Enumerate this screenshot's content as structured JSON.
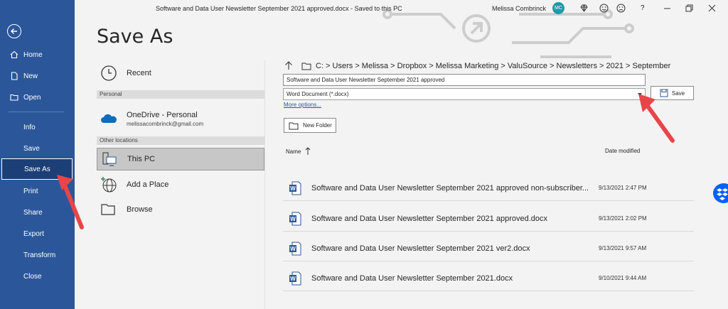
{
  "window": {
    "doc_title": "Software and Data User Newsletter September 2021 approved.docx  -  Saved to this PC",
    "user_name": "Melissa Combrinck",
    "user_initials": "MC",
    "help_label": "?"
  },
  "nav": {
    "items": [
      {
        "label": "Home"
      },
      {
        "label": "New"
      },
      {
        "label": "Open"
      },
      {
        "label": "Info"
      },
      {
        "label": "Save"
      },
      {
        "label": "Save As"
      },
      {
        "label": "Print"
      },
      {
        "label": "Share"
      },
      {
        "label": "Export"
      },
      {
        "label": "Transform"
      },
      {
        "label": "Close"
      }
    ]
  },
  "page": {
    "title": "Save As"
  },
  "locations": {
    "recent": "Recent",
    "personal_header": "Personal",
    "onedrive_name": "OneDrive - Personal",
    "onedrive_email": "melissacombrinck@gmail.com",
    "other_header": "Other locations",
    "this_pc": "This PC",
    "add_place": "Add a Place",
    "browse": "Browse"
  },
  "save_pane": {
    "path": "C: > Users > Melissa > Dropbox > Melissa Marketing > ValuSource > Newsletters > 2021 > September",
    "filename": "Software and Data User Newsletter September 2021 approved",
    "filetype": "Word Document (*.docx)",
    "save_label": "Save",
    "more_options": "More options...",
    "new_folder": "New Folder",
    "col_name": "Name",
    "col_date": "Date modified"
  },
  "files": [
    {
      "name": "Software and Data User Newsletter September 2021 approved non-subscriber...",
      "date": "9/13/2021 2:47 PM"
    },
    {
      "name": "Software and Data User Newsletter September 2021 approved.docx",
      "date": "9/13/2021 2:02 PM"
    },
    {
      "name": "Software and Data User Newsletter September 2021 ver2.docx",
      "date": "9/13/2021 9:57 AM"
    },
    {
      "name": "Software and Data User Newsletter September 2021.docx",
      "date": "9/10/2021 9:44 AM"
    }
  ],
  "colors": {
    "nav_bg": "#2b579a",
    "nav_active": "#1b3f76",
    "annotation_arrow": "#e8454a",
    "word_blue": "#2b579a",
    "dropbox_blue": "#0061fe"
  }
}
